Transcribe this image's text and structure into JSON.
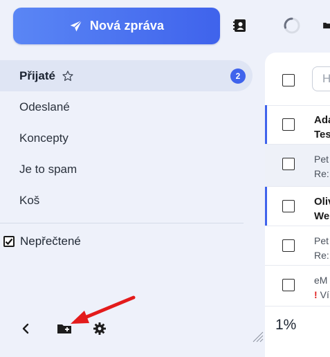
{
  "compose": {
    "label": "Nová zpráva",
    "icon": "paper-plane-icon"
  },
  "topbar": {
    "icons": [
      "contacts-icon",
      "loading-spinner-icon",
      "folder-icon"
    ]
  },
  "sidebar": {
    "items": [
      {
        "label": "Přijaté",
        "badge": "2",
        "active": true,
        "icon": "star-outline-icon"
      },
      {
        "label": "Odeslané"
      },
      {
        "label": "Koncepty"
      },
      {
        "label": "Je to spam"
      },
      {
        "label": "Koš"
      }
    ],
    "unread_filter": {
      "label": "Nepřečtené",
      "checked": true
    },
    "bottom_icons": [
      "chevron-left-icon",
      "folder-manage-icon",
      "gear-icon"
    ]
  },
  "mail_list": {
    "search_placeholder": "H",
    "rows": [
      {
        "sender": "Ada",
        "subject": "Tes",
        "unread": true
      },
      {
        "sender": "Pet",
        "subject": "Re:",
        "unread": false,
        "selected": true
      },
      {
        "sender": "Oliv",
        "subject": "We",
        "unread": true
      },
      {
        "sender": "Pet",
        "subject": "Re:",
        "unread": false
      },
      {
        "sender": "eM",
        "subject": "Ví",
        "unread": false,
        "priority": "!"
      }
    ],
    "percent": "1%"
  },
  "colors": {
    "accent": "#3f63ec",
    "sidebar_bg": "#eef1fa",
    "annotation_arrow": "#e31b1b"
  }
}
